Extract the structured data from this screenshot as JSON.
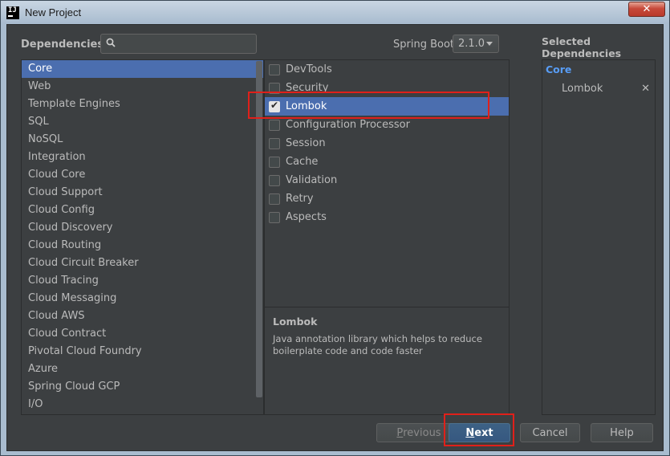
{
  "window": {
    "title": "New Project",
    "close_symbol": "✕"
  },
  "header": {
    "dependencies_label": "Dependencies",
    "search_placeholder": "",
    "spring_boot_label": "Spring Boot",
    "spring_boot_version": "2.1.0",
    "selected_title": "Selected Dependencies"
  },
  "categories": {
    "selected": "Core",
    "items": [
      "Core",
      "Web",
      "Template Engines",
      "SQL",
      "NoSQL",
      "Integration",
      "Cloud Core",
      "Cloud Support",
      "Cloud Config",
      "Cloud Discovery",
      "Cloud Routing",
      "Cloud Circuit Breaker",
      "Cloud Tracing",
      "Cloud Messaging",
      "Cloud AWS",
      "Cloud Contract",
      "Pivotal Cloud Foundry",
      "Azure",
      "Spring Cloud GCP",
      "I/O"
    ]
  },
  "dependencies": {
    "items": [
      {
        "label": "DevTools",
        "checked": false
      },
      {
        "label": "Security",
        "checked": false
      },
      {
        "label": "Lombok",
        "checked": true
      },
      {
        "label": "Configuration Processor",
        "checked": false
      },
      {
        "label": "Session",
        "checked": false
      },
      {
        "label": "Cache",
        "checked": false
      },
      {
        "label": "Validation",
        "checked": false
      },
      {
        "label": "Retry",
        "checked": false
      },
      {
        "label": "Aspects",
        "checked": false
      }
    ],
    "highlighted": "Lombok"
  },
  "description": {
    "title": "Lombok",
    "text": "Java annotation library which helps to reduce boilerplate code and code faster"
  },
  "selected_dependencies": {
    "group": "Core",
    "items": [
      {
        "label": "Lombok",
        "remove_symbol": "✕"
      }
    ]
  },
  "buttons": {
    "previous": {
      "mnemonic": "P",
      "rest": "revious"
    },
    "next": {
      "mnemonic": "N",
      "rest": "ext"
    },
    "cancel": "Cancel",
    "help": "Help"
  },
  "colors": {
    "selection": "#4b6eaf",
    "accent_group": "#589df6",
    "highlight_box": "#e0201a"
  }
}
